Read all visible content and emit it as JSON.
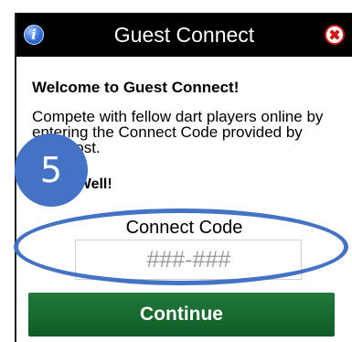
{
  "dialog": {
    "title": "Guest Connect",
    "info_icon_glyph": "i",
    "icons": {
      "info": "info-icon",
      "close": "close-icon"
    },
    "welcome_heading": "Welcome to Guest Connect!",
    "body_text": "Compete with fellow dart players online by entering the Connect Code provided by your host.",
    "closing_text": "Shoot Well!",
    "connect_code_label": "Connect Code",
    "connect_code_placeholder": "###-###",
    "continue_label": "Continue"
  },
  "annotation": {
    "step_number": "5",
    "badge_color": "#4472c4",
    "ring_color": "#4472c4"
  },
  "colors": {
    "titlebar": "#000000",
    "continue_button": "#15672f",
    "close_icon": "#d31818"
  }
}
